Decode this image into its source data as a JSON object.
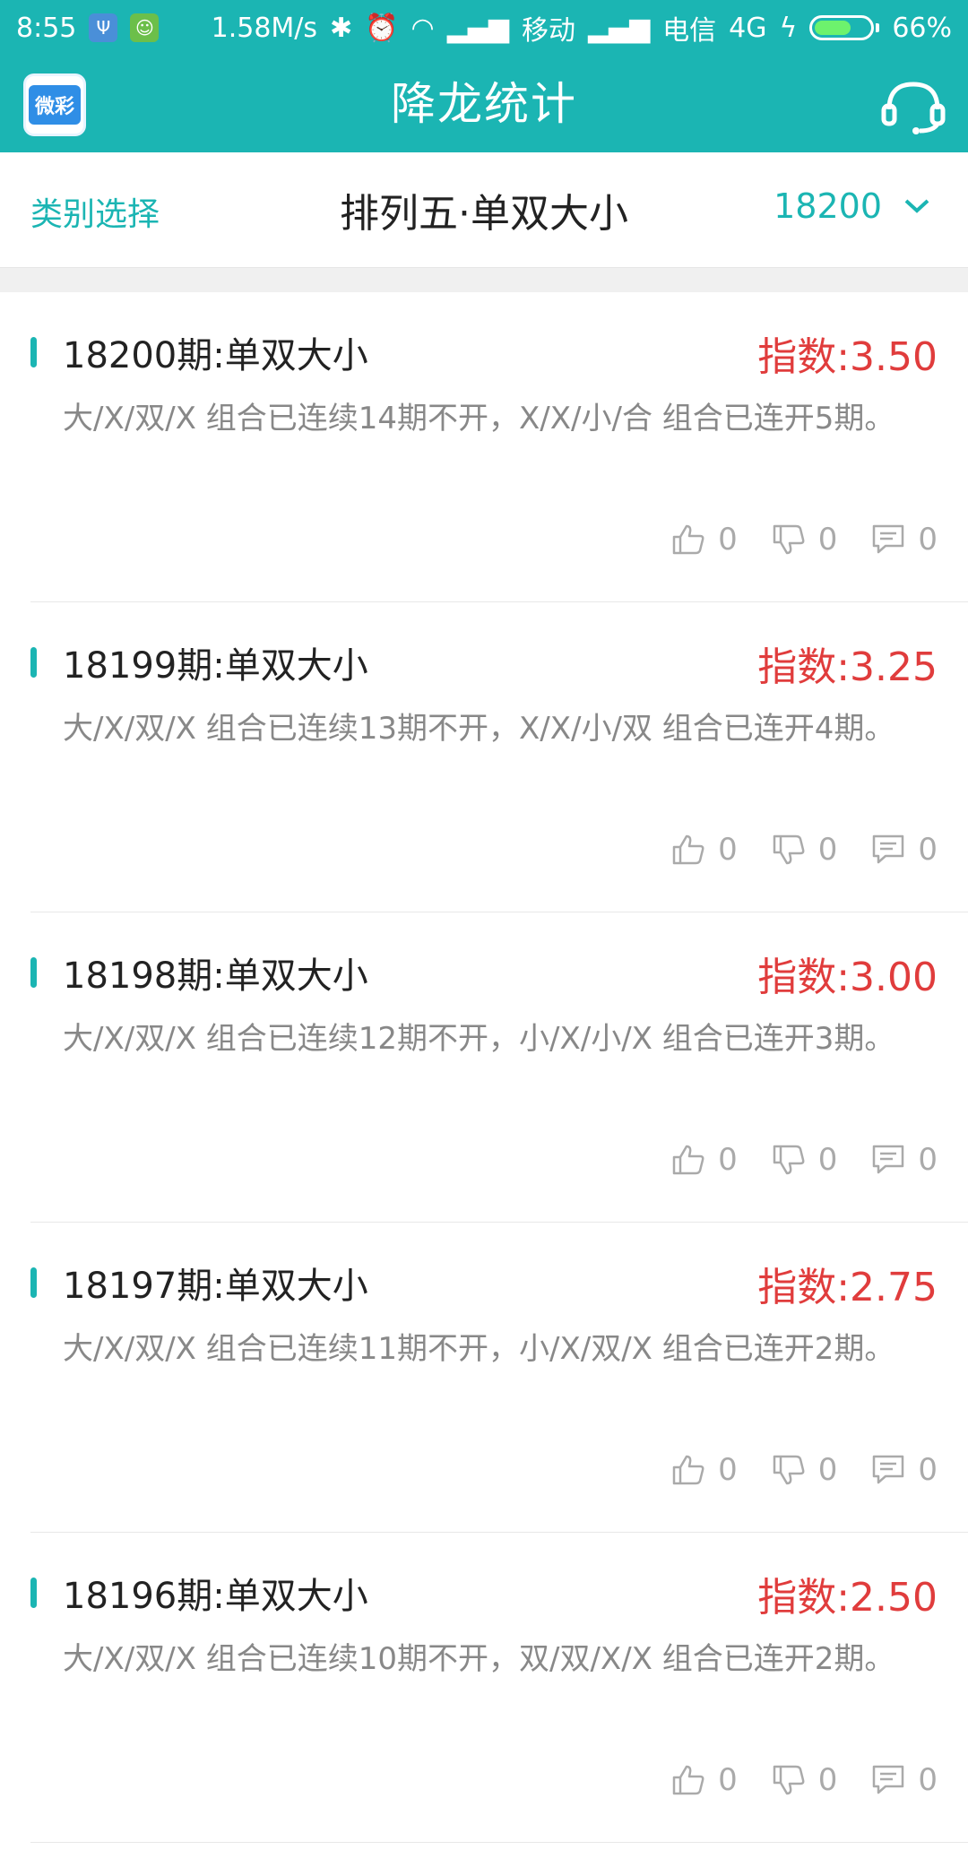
{
  "status_bar": {
    "time": "8:55",
    "net_speed": "1.58M/s",
    "carrier1": "移动",
    "carrier2": "电信",
    "network": "4G",
    "battery": "66%",
    "battery_level": 0.66
  },
  "header": {
    "logo_text": "微彩",
    "title": "降龙统计"
  },
  "filter": {
    "category_label": "类别选择",
    "title": "排列五·单双大小",
    "period": "18200"
  },
  "items": [
    {
      "title": "18200期:单双大小",
      "index": "指数:3.50",
      "desc": "大/X/双/X 组合已连续14期不开，X/X/小/合 组合已连开5期。",
      "likes": "0",
      "dislikes": "0",
      "comments": "0"
    },
    {
      "title": "18199期:单双大小",
      "index": "指数:3.25",
      "desc": "大/X/双/X 组合已连续13期不开，X/X/小/双 组合已连开4期。",
      "likes": "0",
      "dislikes": "0",
      "comments": "0"
    },
    {
      "title": "18198期:单双大小",
      "index": "指数:3.00",
      "desc": "大/X/双/X 组合已连续12期不开，小/X/小/X 组合已连开3期。",
      "likes": "0",
      "dislikes": "0",
      "comments": "0"
    },
    {
      "title": "18197期:单双大小",
      "index": "指数:2.75",
      "desc": "大/X/双/X 组合已连续11期不开，小/X/双/X 组合已连开2期。",
      "likes": "0",
      "dislikes": "0",
      "comments": "0"
    },
    {
      "title": "18196期:单双大小",
      "index": "指数:2.50",
      "desc": "大/X/双/X 组合已连续10期不开，双/双/X/X 组合已连开2期。",
      "likes": "0",
      "dislikes": "0",
      "comments": "0"
    }
  ],
  "colors": {
    "primary": "#1BB5B3",
    "index_red": "#E03C3C",
    "muted": "#888888"
  }
}
